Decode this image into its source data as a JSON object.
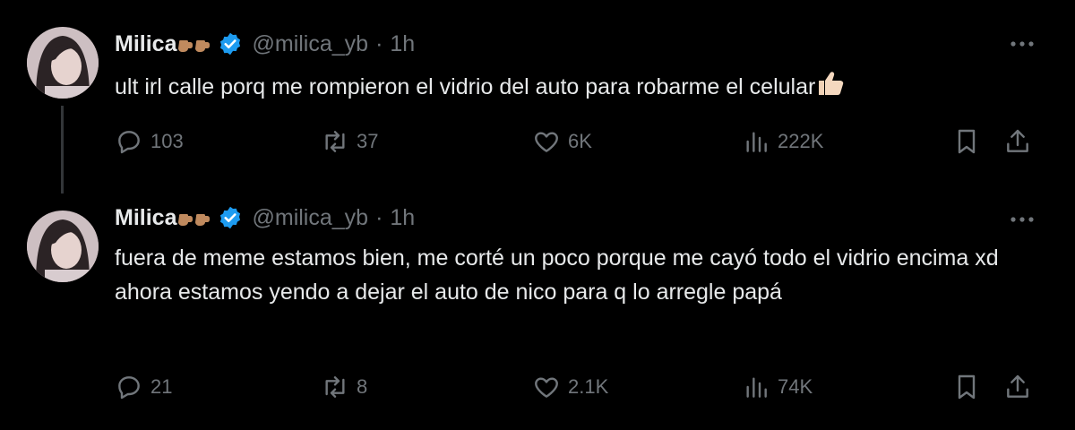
{
  "tweets": [
    {
      "author": {
        "display_name": "Milica",
        "name_emoji": "backhand-index-pointing-right-medium-skin-tone x2",
        "verified_icon": "verified-badge-icon",
        "handle": "@milica_yb",
        "separator": "·",
        "time": "1h"
      },
      "text": "ult irl calle porq me rompieron el vidrio del auto para robarme el celular",
      "text_emoji": "thumbs-up-light-skin-tone",
      "stats": {
        "replies": "103",
        "retweets": "37",
        "likes": "6K",
        "views": "222K"
      }
    },
    {
      "author": {
        "display_name": "Milica",
        "name_emoji": "backhand-index-pointing-right-medium-skin-tone x2",
        "verified_icon": "verified-badge-icon",
        "handle": "@milica_yb",
        "separator": "·",
        "time": "1h"
      },
      "text": "fuera de meme estamos bien, me corté un poco porque me cayó todo el vidrio encima xd ahora estamos yendo a dejar el auto de nico para q lo arregle papá",
      "stats": {
        "replies": "21",
        "retweets": "8",
        "likes": "2.1K",
        "views": "74K"
      }
    }
  ],
  "colors": {
    "background": "#000000",
    "primary_text": "#e7e9ea",
    "secondary_text": "#71767b",
    "verified_blue": "#1d9bf0",
    "thread_line": "#333639"
  },
  "icons": [
    "more-icon",
    "reply-icon",
    "retweet-icon",
    "like-icon",
    "views-icon",
    "bookmark-icon",
    "share-icon"
  ]
}
